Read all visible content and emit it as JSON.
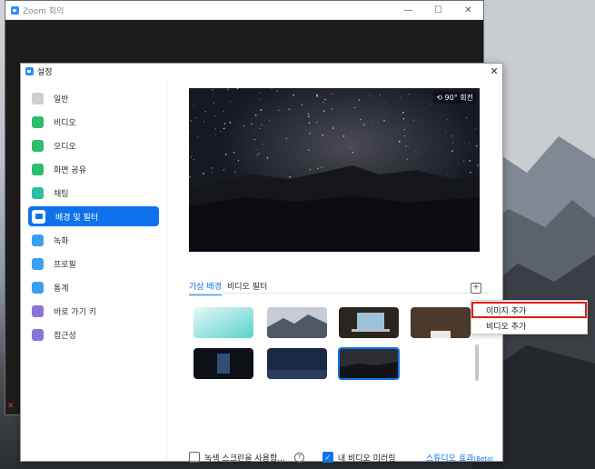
{
  "zoom_window": {
    "title": "Zoom 회의",
    "controls": [
      "—",
      "☐",
      "✕"
    ]
  },
  "settings": {
    "title": "설정",
    "close": "✕",
    "sidebar": [
      {
        "label": "일반",
        "icon": "gear-icon",
        "color": "#cfcfcf"
      },
      {
        "label": "비디오",
        "icon": "video-icon",
        "color": "#2ebd6b"
      },
      {
        "label": "오디오",
        "icon": "headphones-icon",
        "color": "#2ebd6b"
      },
      {
        "label": "화면 공유",
        "icon": "share-screen-icon",
        "color": "#2ebd6b"
      },
      {
        "label": "채팅",
        "icon": "chat-icon",
        "color": "#2ebda5"
      },
      {
        "label": "배경 및 필터",
        "icon": "background-icon",
        "color": "#ffffff",
        "active": true
      },
      {
        "label": "녹화",
        "icon": "record-icon",
        "color": "#3aa0f0"
      },
      {
        "label": "프로필",
        "icon": "profile-icon",
        "color": "#3aa0f0"
      },
      {
        "label": "통계",
        "icon": "statistics-icon",
        "color": "#3aa0f0"
      },
      {
        "label": "바로 가기 키",
        "icon": "keyboard-icon",
        "color": "#8a74d6"
      },
      {
        "label": "접근성",
        "icon": "accessibility-icon",
        "color": "#8a74d6"
      }
    ],
    "rotate_label": "90° 회전",
    "tabs": [
      "가상 배경",
      "비디오 필터"
    ],
    "add_label": "+",
    "menu": [
      "이미지 추가",
      "비디오 추가"
    ],
    "green_screen_label": "녹색 스크린을 사용합...",
    "mirror_label": "내 비디오 미러링",
    "studio_label": "스튜디오 효과",
    "studio_beta": "(Beta)",
    "help": "?"
  },
  "colors": {
    "accent": "#0e72ed",
    "highlight_box": "#e21b1b"
  }
}
